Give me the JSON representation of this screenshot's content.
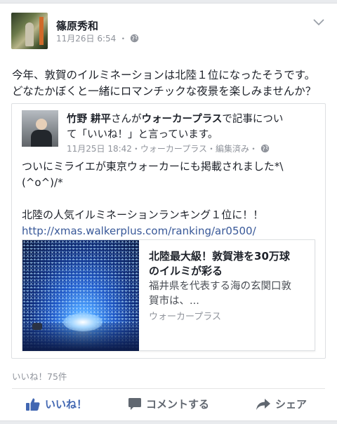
{
  "post": {
    "author": "篠原秀和",
    "date": "11月26日 6:54",
    "audience_icon": "globe-icon",
    "text_line1": "今年、敦賀のイルミネーションは北陸１位になったそうです。",
    "text_line2": "どなたかぼくと一緒にロマンチックな夜景を楽しみませんか？"
  },
  "shared": {
    "author": "竹野 耕平",
    "connector": "さんが",
    "page": "ウォーカープラス",
    "action_line1_tail": "で記事につい",
    "action_line2": "て「いいね！」と言っています。",
    "meta": "11月25日 18:42・ウォーカープラス・編集済み・",
    "line1": "ついにミライエが東京ウォーカーにも掲載されました*\\",
    "line2": "(^o^)/*",
    "line3": "北陸の人気イルミネーションランキング１位に！！",
    "url": "http://xmas.walkerplus.com/ranking/ar0500/"
  },
  "link_card": {
    "title_line1": "北陸最大級！敦賀港を30万球",
    "title_line2": "のイルミが彩る",
    "desc_line1": "福井県を代表する海の玄関口敦",
    "desc_line2": "賀市は、...",
    "source": "ウォーカープラス"
  },
  "stats": {
    "likes": "いいね！75件"
  },
  "actions": {
    "like": "いいね！",
    "comment": "コメントする",
    "share": "シェア"
  },
  "colors": {
    "link": "#385898",
    "like_active": "#4267b2",
    "meta_gray": "#90949c"
  }
}
